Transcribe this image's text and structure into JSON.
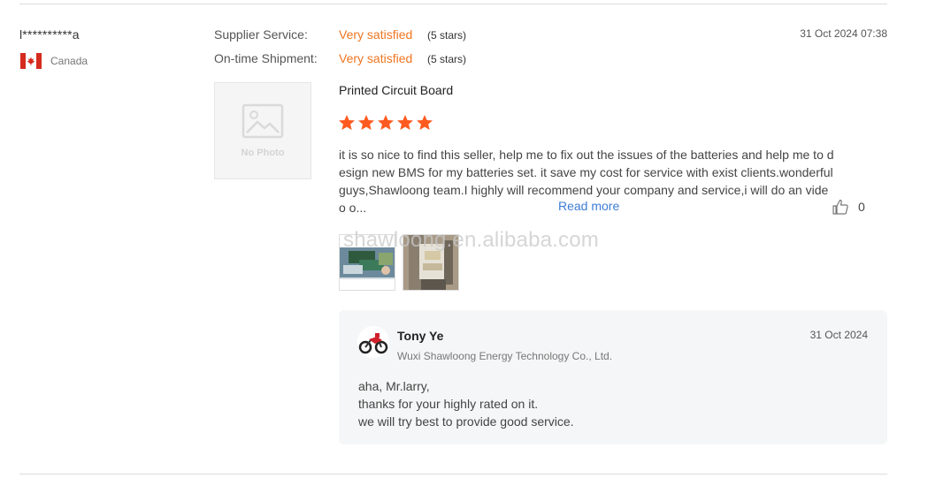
{
  "review": {
    "buyer_name": "l**********a",
    "country": "Canada",
    "supplier_service_label": "Supplier Service:",
    "supplier_service_value": "Very satisfied",
    "supplier_service_stars": "(5 stars)",
    "shipment_label": "On-time Shipment:",
    "shipment_value": "Very satisfied",
    "shipment_stars": "(5 stars)",
    "date": "31 Oct 2024 07:38",
    "no_photo_text": "No Photo",
    "product_name": "Printed Circuit Board",
    "rating": 5,
    "text": "it is so nice to find this seller, help me to fix out the issues of the batteries and help me to design new BMS for my batteries set. it save my cost for service with exist clients.wonderful guys,Shawloong team.I highly will recommend your company and service,i will do an video o...",
    "read_more": "Read more",
    "likes": "0",
    "watermark": "shawloong.en.alibaba.com"
  },
  "reply": {
    "name": "Tony Ye",
    "company": "Wuxi Shawloong Energy Technology Co., Ltd.",
    "date": "31 Oct 2024",
    "lines": [
      "aha, Mr.larry,",
      "thanks for your highly rated on it.",
      "we will try best to provide good service."
    ]
  },
  "colors": {
    "accent_orange": "#f07521",
    "star": "#ff5a1f",
    "link_blue": "#3d7dd6",
    "reply_bg": "#f5f6f7"
  },
  "icons": [
    "canada-flag-icon",
    "no-photo-icon",
    "star-icon",
    "thumbs-up-icon",
    "motorcycle-avatar"
  ]
}
